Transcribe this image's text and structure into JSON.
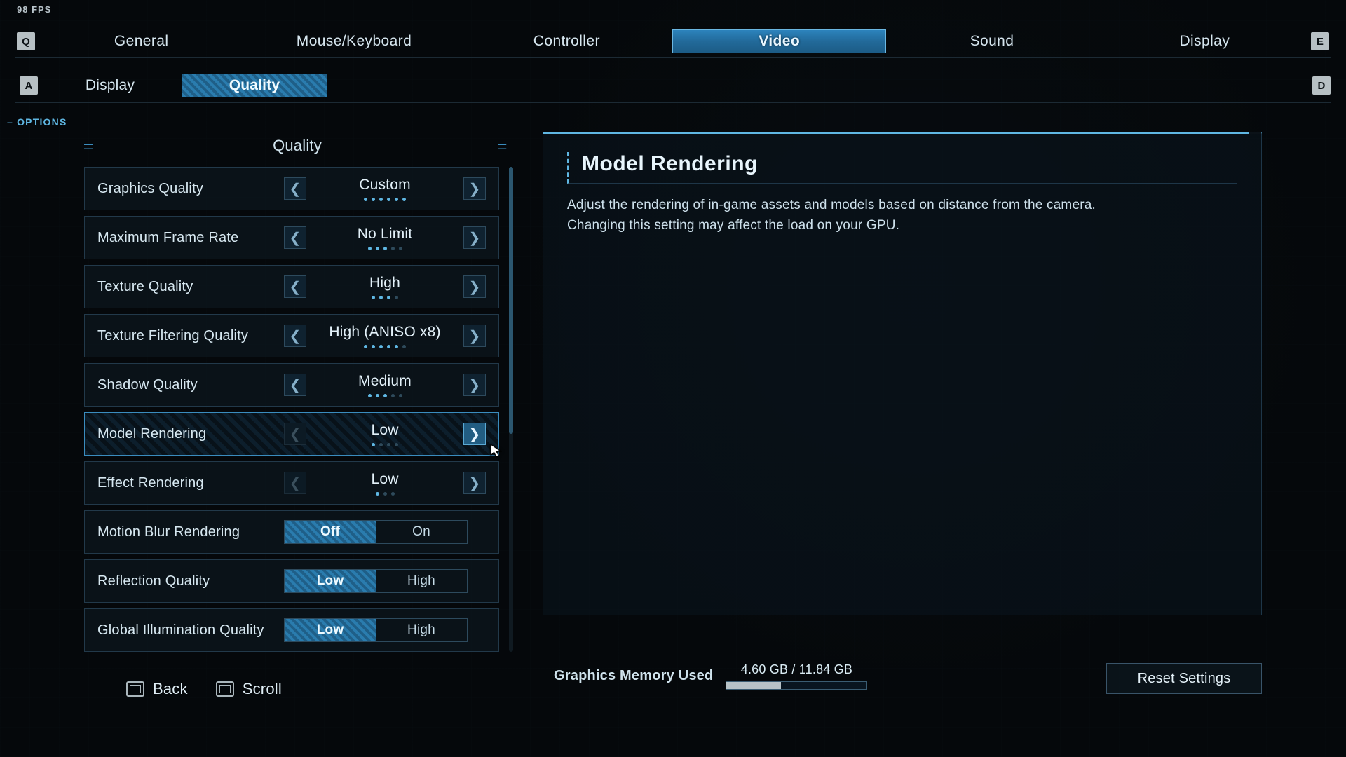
{
  "fps": "98 FPS",
  "topNav": {
    "keyLeft": "Q",
    "keyRight": "E",
    "tabs": [
      "General",
      "Mouse/Keyboard",
      "Controller",
      "Video",
      "Sound",
      "Display"
    ],
    "activeIndex": 3
  },
  "subNav": {
    "keyLeft": "A",
    "keyRight": "D",
    "tabs": [
      "Display",
      "Quality"
    ],
    "activeIndex": 1
  },
  "optionsLabel": "OPTIONS",
  "sectionTitle": "Quality",
  "settings": [
    {
      "label": "Graphics Quality",
      "type": "spinner",
      "value": "Custom",
      "dots": 6,
      "dotOn": 6,
      "selected": false,
      "leftDim": false
    },
    {
      "label": "Maximum Frame Rate",
      "type": "spinner",
      "value": "No Limit",
      "dots": 5,
      "dotOn": 3,
      "selected": false
    },
    {
      "label": "Texture Quality",
      "type": "spinner",
      "value": "High",
      "dots": 4,
      "dotOn": 3,
      "selected": false
    },
    {
      "label": "Texture Filtering Quality",
      "type": "spinner",
      "value": "High (ANISO x8)",
      "dots": 6,
      "dotOn": 5,
      "selected": false
    },
    {
      "label": "Shadow Quality",
      "type": "spinner",
      "value": "Medium",
      "dots": 5,
      "dotOn": 3,
      "selected": false
    },
    {
      "label": "Model Rendering",
      "type": "spinner",
      "value": "Low",
      "dots": 4,
      "dotOn": 1,
      "selected": true,
      "leftDim": true,
      "rightHot": true
    },
    {
      "label": "Effect Rendering",
      "type": "spinner",
      "value": "Low",
      "dots": 3,
      "dotOn": 1,
      "selected": false,
      "leftDim": true
    },
    {
      "label": "Motion Blur Rendering",
      "type": "toggle",
      "options": [
        "Off",
        "On"
      ],
      "activeOption": 0
    },
    {
      "label": "Reflection Quality",
      "type": "toggle",
      "options": [
        "Low",
        "High"
      ],
      "activeOption": 0
    },
    {
      "label": "Global Illumination Quality",
      "type": "toggle",
      "options": [
        "Low",
        "High"
      ],
      "activeOption": 0
    }
  ],
  "detail": {
    "title": "Model Rendering",
    "body": "Adjust the rendering of in-game assets and models based on distance from the camera. Changing this setting may affect the load on your GPU."
  },
  "memory": {
    "label": "Graphics Memory Used",
    "value": "4.60 GB / 11.84 GB",
    "percent": 39
  },
  "reset": "Reset Settings",
  "footerActions": [
    "Back",
    "Scroll"
  ]
}
